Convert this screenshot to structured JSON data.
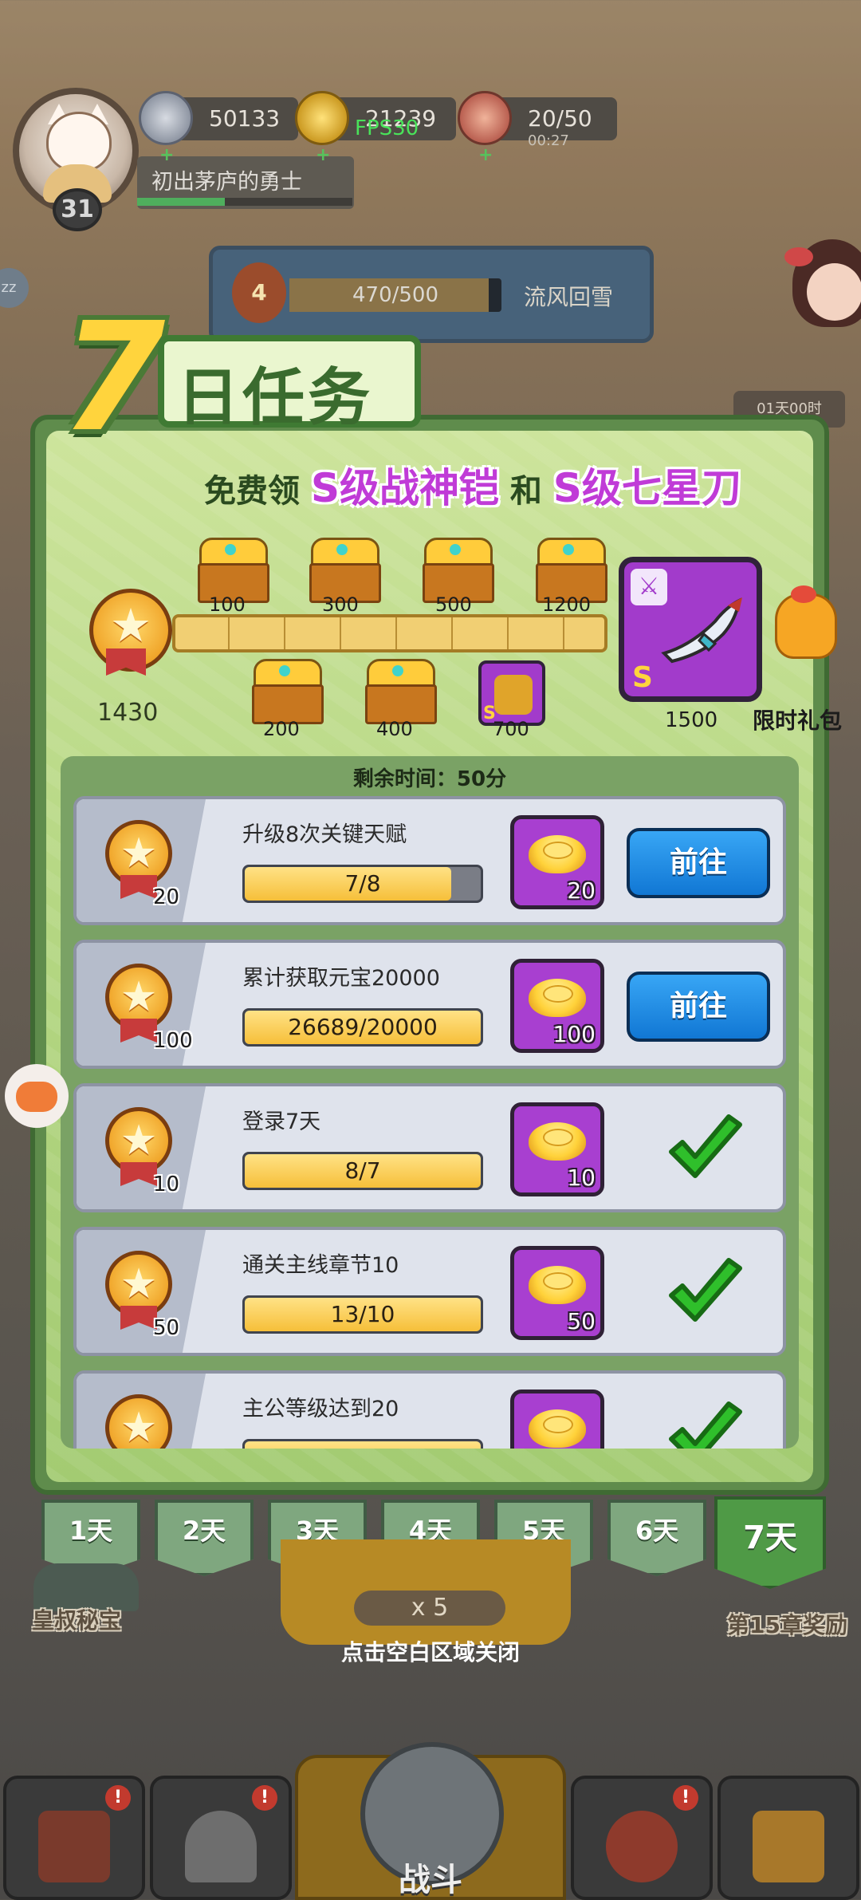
{
  "hud": {
    "player_level": "31",
    "player_title": "初出茅庐的勇士",
    "coins": "50133",
    "gold": "21239",
    "fps": "FPS30",
    "stamina": "20/50",
    "stamina_timer": "00:27",
    "chapter_badge": "4",
    "chapter_progress_text": "470/500",
    "chapter_progress_fraction": 0.94,
    "chapter_name": "流风回雪",
    "side_timer": "01天00时",
    "side_left_label": "zz"
  },
  "event": {
    "title_number": "7",
    "title_text": "日任务",
    "promo_prefix": "免费领",
    "promo_item1": "S级战神铠",
    "promo_mid": "和",
    "promo_item2": "S级七星刀",
    "total_points": "1430",
    "milestones_top": [
      "100",
      "300",
      "500",
      "1200"
    ],
    "milestones_bottom": [
      "200",
      "400",
      "700"
    ],
    "milestone_700_grade": "S",
    "final_reward_grade": "S",
    "final_reward_points": "1500",
    "gift_label": "限时礼包",
    "remaining": "剩余时间：50分"
  },
  "tasks": [
    {
      "points": "20",
      "name": "升级8次关键天赋",
      "progress": "7/8",
      "fraction": 0.875,
      "reward": "20",
      "action": "前往",
      "done": false
    },
    {
      "points": "100",
      "name": "累计获取元宝20000",
      "progress": "26689/20000",
      "fraction": 1.0,
      "reward": "100",
      "action": "前往",
      "done": false
    },
    {
      "points": "10",
      "name": "登录7天",
      "progress": "8/7",
      "fraction": 1.0,
      "reward": "10",
      "done": true
    },
    {
      "points": "50",
      "name": "通关主线章节10",
      "progress": "13/10",
      "fraction": 1.0,
      "reward": "50",
      "done": true
    },
    {
      "points": "",
      "name": "主公等级达到20",
      "progress": "",
      "fraction": 1.0,
      "reward": "",
      "done": true
    }
  ],
  "day_tabs": [
    "1天",
    "2天",
    "3天",
    "4天",
    "5天",
    "6天",
    "7天"
  ],
  "active_day": "7天",
  "background": {
    "left_label": "皇叔秘宝",
    "right_label": "第15章奖励",
    "meat_chip": "x 5",
    "close_hint": "点击空白区域关闭",
    "battle_label": "战斗",
    "nav_badge": "!"
  },
  "colors": {
    "panel_green": "#5f8c4c",
    "promo_purple": "#c03bd7",
    "go_button": "#1a8ce6",
    "reward_purple": "#a83fd0",
    "check_green": "#2fbf2b"
  }
}
